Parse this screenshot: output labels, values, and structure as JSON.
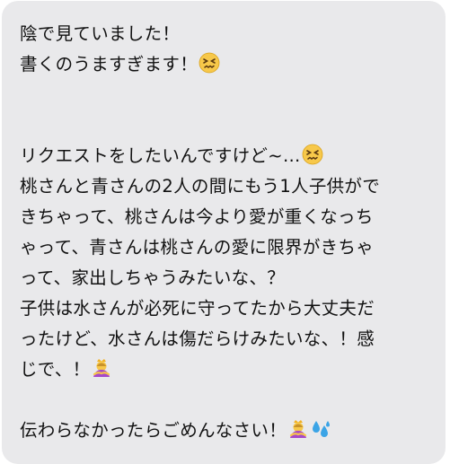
{
  "message": {
    "paragraphs": [
      {
        "lines": [
          "陰で見ていました！",
          "書くのうますぎます！"
        ],
        "end_emoji": [
          "confounded-face"
        ]
      },
      {
        "lines": [
          "リクエストをしたいんですけど~…",
          "桃さんと青さんの2人の間にもう1人子供がで",
          "きちゃって、桃さんは今より愛が重くなっち",
          "ゃって、青さんは桃さんの愛に限界がきちゃ",
          "って、家出しちゃうみたいな、？",
          "子供は水さんが必死に守ってたから大丈夫だ",
          "ったけど、水さんは傷だらけみたいな、！感",
          "じで、！"
        ]
      },
      {
        "lines": [
          "伝わらなかったらごめんなさい！"
        ],
        "end_emoji": [
          "person-bowing-crown",
          "sweat-droplets"
        ]
      }
    ]
  },
  "colors": {
    "bubble_background": "#e9e9eb",
    "text": "#111111",
    "emoji_face": "#f7c84a",
    "emoji_sweat": "#3ba4e6"
  }
}
